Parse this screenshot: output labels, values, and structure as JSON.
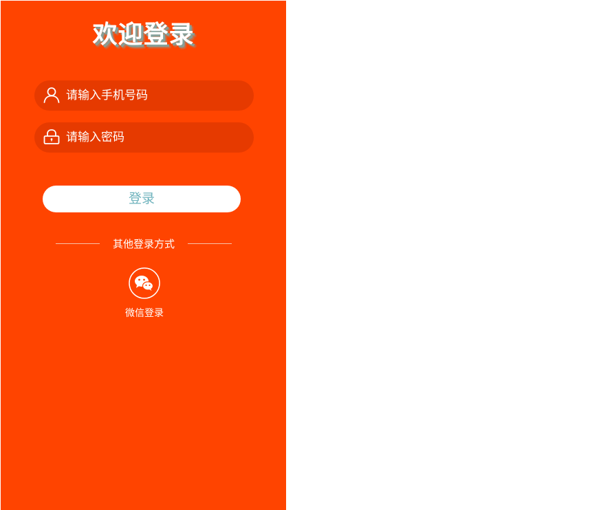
{
  "page": {
    "title": "欢迎登录"
  },
  "form": {
    "phone_placeholder": "请输入手机号码",
    "password_placeholder": "请输入密码",
    "login_label": "登录"
  },
  "other_login": {
    "divider_text": "其他登录方式",
    "wechat_label": "微信登录"
  },
  "icons": {
    "phone": "user-icon",
    "password": "lock-icon",
    "wechat": "wechat-icon"
  },
  "colors": {
    "background": "#ff4400",
    "input_background": "#e63a00",
    "login_text": "#6fb3bd",
    "title_shadow": "#78aaaa"
  }
}
